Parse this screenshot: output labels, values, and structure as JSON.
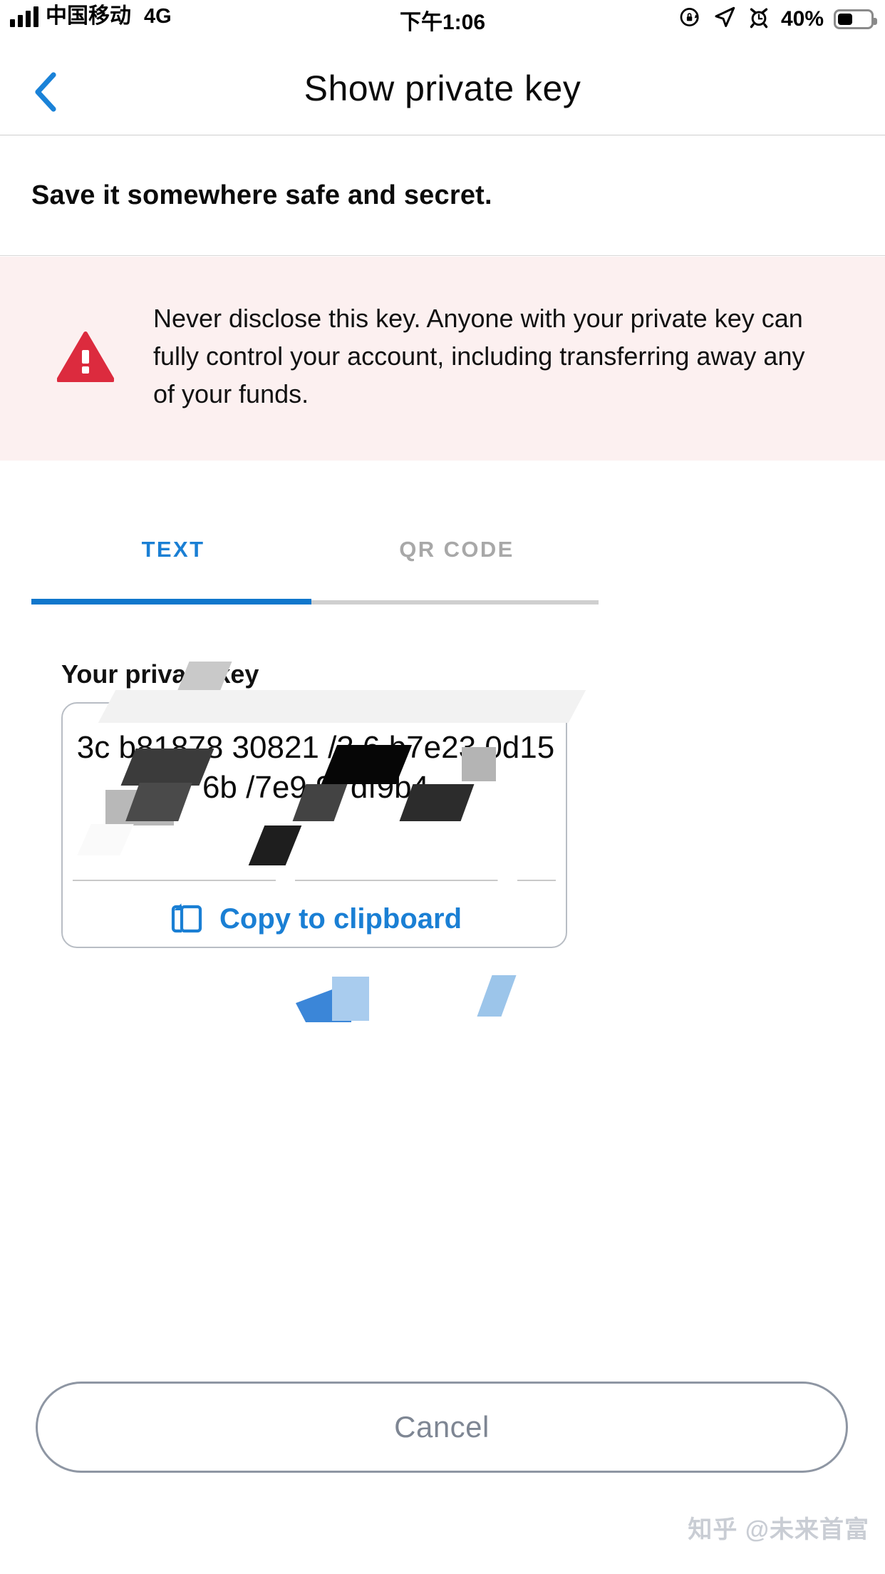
{
  "status_bar": {
    "carrier": "中国移动",
    "network_type": "4G",
    "time": "下午1:06",
    "battery_percent": "40%",
    "battery_level": 40,
    "icons": [
      "signal-bars-icon",
      "rotation-lock-icon",
      "location-arrow-icon",
      "alarm-clock-icon",
      "battery-icon"
    ]
  },
  "nav": {
    "back_icon": "chevron-left-icon",
    "title": "Show private key"
  },
  "subtitle": "Save it somewhere safe and secret.",
  "warning": {
    "icon": "warning-triangle-icon",
    "text": "Never disclose this key. Anyone with your private key can fully control your account, including transferring away any of your funds.",
    "background": "#fcf0f0",
    "icon_color": "#dc2b3e"
  },
  "tabs": {
    "items": [
      {
        "label": "TEXT",
        "active": true
      },
      {
        "label": "QR CODE",
        "active": false
      }
    ],
    "active_color": "#1a7fd4",
    "inactive_color": "#a8a8a8",
    "underline_color": "#1077cc"
  },
  "key_section": {
    "label": "Your private key",
    "key_value": "3c      b81878     30821      /3  6    b7e23     0d156b    /7e9        97df9b4",
    "copy_button": {
      "label": "Copy to clipboard",
      "icon": "copy-icon",
      "color": "#1a7fd4"
    }
  },
  "footer": {
    "cancel_label": "Cancel",
    "cancel_text_color": "#7e8693"
  },
  "watermark": "知乎 @未来首富"
}
